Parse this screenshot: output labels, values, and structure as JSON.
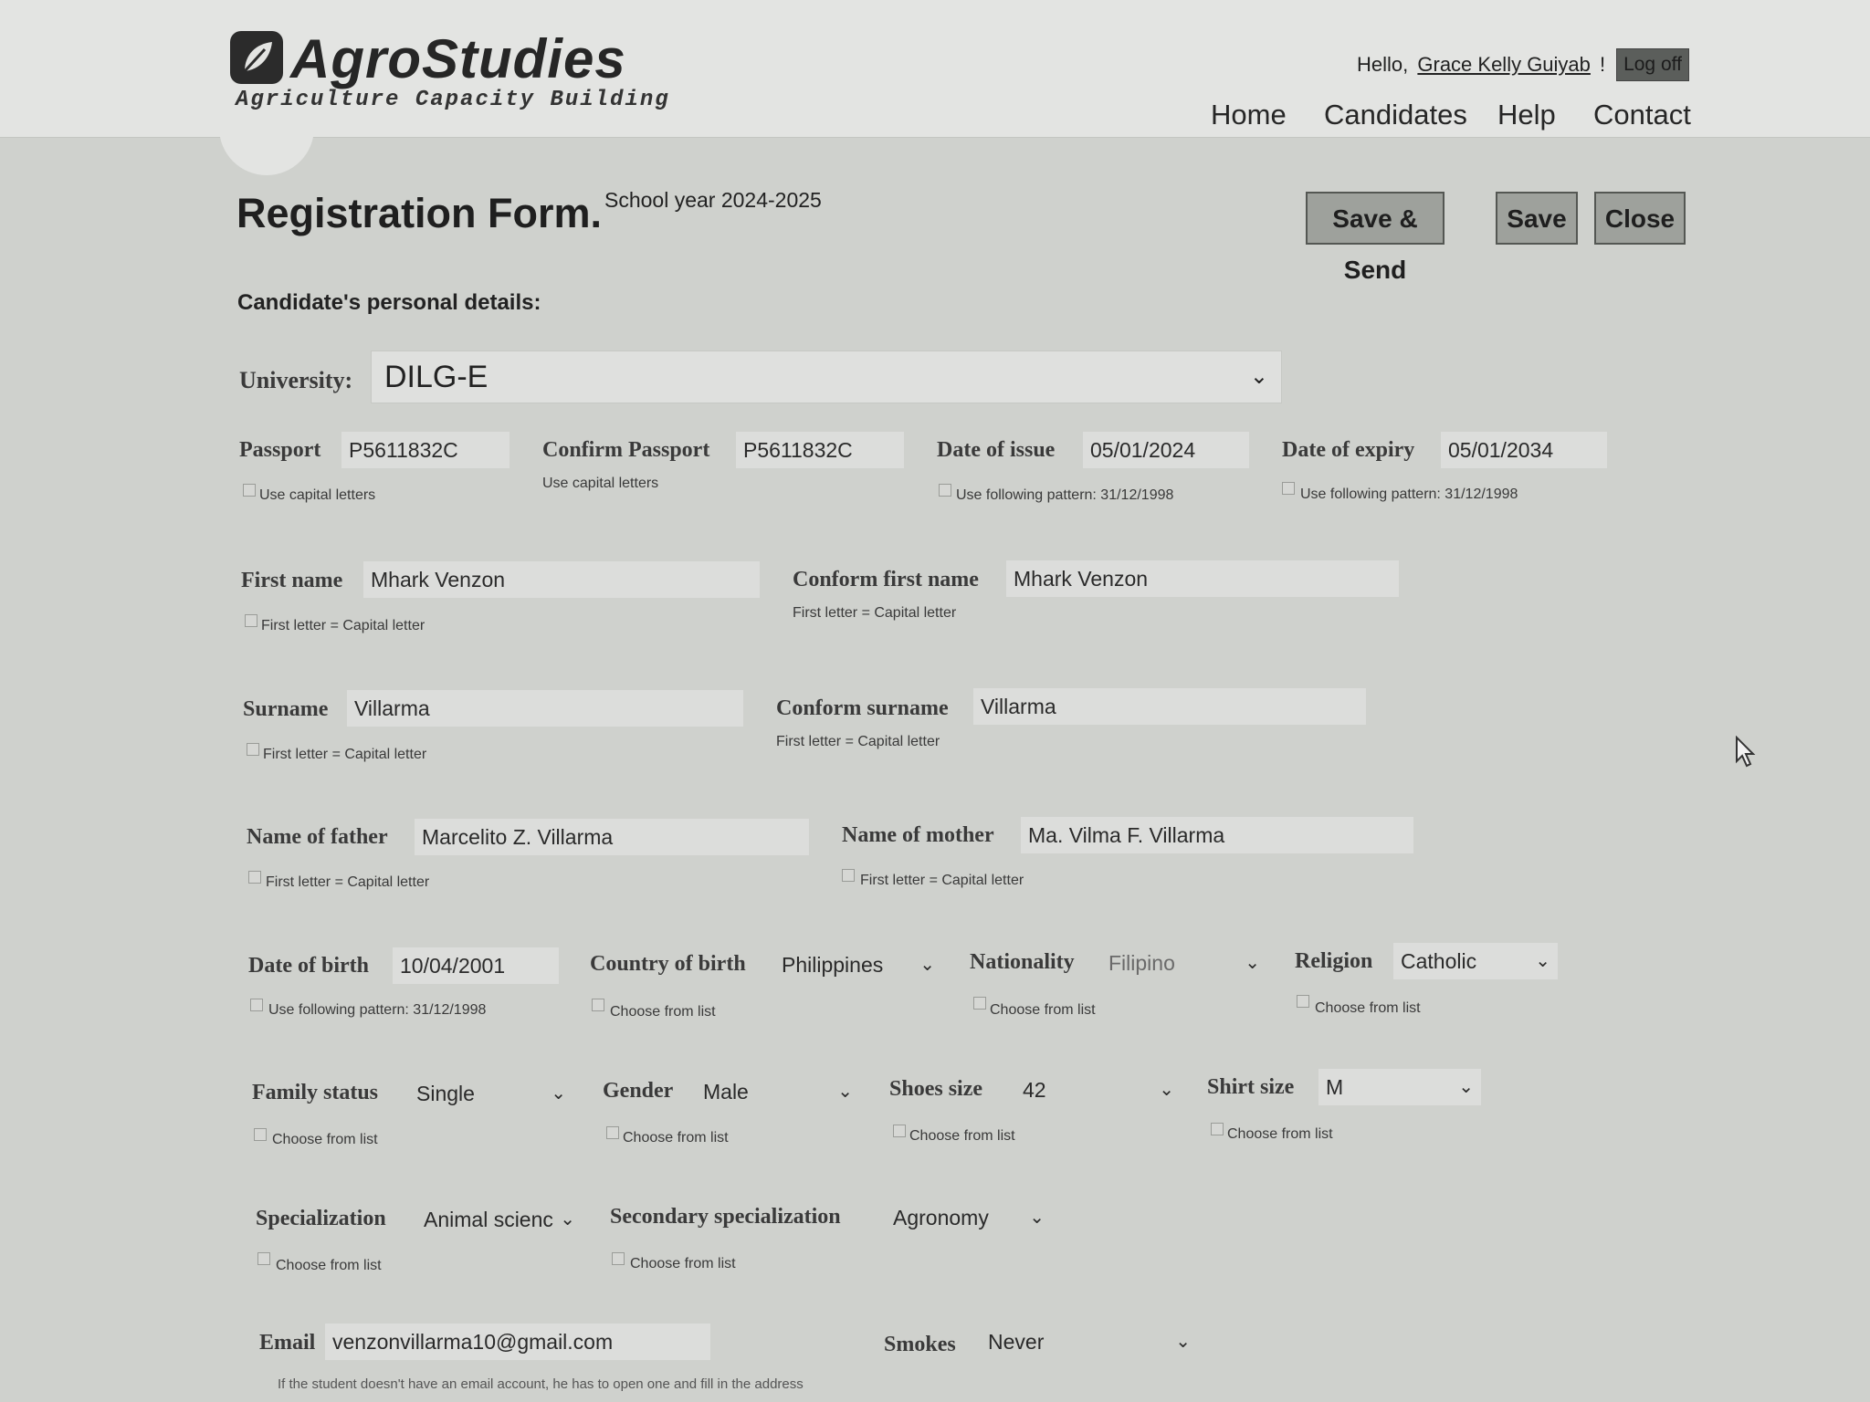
{
  "brand": {
    "name": "AgroStudies",
    "tagline": "Agriculture Capacity Building"
  },
  "user": {
    "greeting": "Hello,",
    "name": "Grace Kelly Guiyab",
    "suffix": "!",
    "logoff": "Log off"
  },
  "nav": [
    "Home",
    "Candidates",
    "Help",
    "Contact"
  ],
  "form": {
    "title": "Registration Form.",
    "school_year": "School year 2024-2025",
    "section": "Candidate's personal details:"
  },
  "buttons": {
    "save_send": "Save & Send",
    "save": "Save",
    "close": "Close"
  },
  "university": {
    "label": "University:",
    "value": "DILG-E"
  },
  "passport": {
    "label": "Passport",
    "value": "P5611832C",
    "hint": "Use capital letters"
  },
  "confirm_passport": {
    "label": "Confirm Passport",
    "value": "P5611832C",
    "hint": "Use capital letters"
  },
  "date_issue": {
    "label": "Date of issue",
    "value": "05/01/2024",
    "hint": "Use following pattern: 31/12/1998"
  },
  "date_expiry": {
    "label": "Date of expiry",
    "value": "05/01/2034",
    "hint": "Use following pattern: 31/12/1998"
  },
  "first_name": {
    "label": "First name",
    "value": "Mhark Venzon",
    "hint": "First letter = Capital letter"
  },
  "confirm_first_name": {
    "label": "Conform first name",
    "value": "Mhark Venzon",
    "hint": "First letter = Capital letter"
  },
  "surname": {
    "label": "Surname",
    "value": "Villarma",
    "hint": "First letter = Capital letter"
  },
  "confirm_surname": {
    "label": "Conform surname",
    "value": "Villarma",
    "hint": "First letter = Capital letter"
  },
  "father": {
    "label": "Name of father",
    "value": "Marcelito Z. Villarma",
    "hint": "First letter = Capital letter"
  },
  "mother": {
    "label": "Name of mother",
    "value": "Ma. Vilma F. Villarma",
    "hint": "First letter = Capital letter"
  },
  "dob": {
    "label": "Date of birth",
    "value": "10/04/2001",
    "hint": "Use following pattern: 31/12/1998"
  },
  "country": {
    "label": "Country of birth",
    "value": "Philippines",
    "hint": "Choose from list"
  },
  "nationality": {
    "label": "Nationality",
    "value": "Filipino",
    "hint": "Choose from list"
  },
  "religion": {
    "label": "Religion",
    "value": "Catholic",
    "hint": "Choose from list"
  },
  "family": {
    "label": "Family status",
    "value": "Single",
    "hint": "Choose from list"
  },
  "gender": {
    "label": "Gender",
    "value": "Male",
    "hint": "Choose from list"
  },
  "shoes": {
    "label": "Shoes size",
    "value": "42",
    "hint": "Choose from list"
  },
  "shirt": {
    "label": "Shirt size",
    "value": "M",
    "hint": "Choose from list"
  },
  "specialization": {
    "label": "Specialization",
    "value": "Animal scienc",
    "hint": "Choose from list"
  },
  "secondary": {
    "label": "Secondary specialization",
    "value": "Agronomy",
    "hint": "Choose from list"
  },
  "email": {
    "label": "Email",
    "value": "venzonvillarma10@gmail.com",
    "hint": "If the student doesn't have an email account, he has to open one and fill in the address"
  },
  "smokes": {
    "label": "Smokes",
    "value": "Never"
  }
}
